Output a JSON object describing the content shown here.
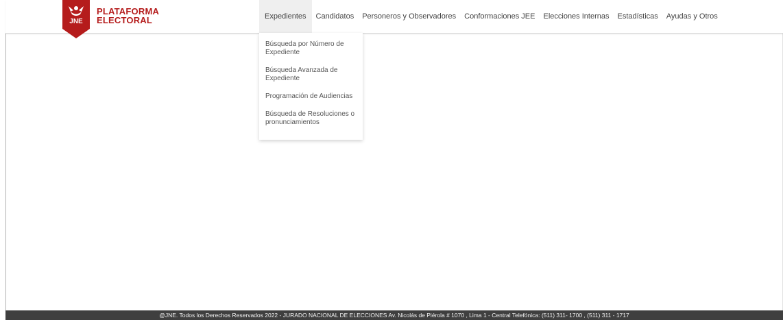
{
  "brand": {
    "shield_text": "JNE",
    "line1": "PLATAFORMA",
    "line2": "ELECTORAL",
    "primary_color": "#b51c1c"
  },
  "nav": {
    "items": [
      {
        "label": "Expedientes",
        "active": true
      },
      {
        "label": "Candidatos"
      },
      {
        "label": "Personeros y Observadores"
      },
      {
        "label": "Conformaciones JEE"
      },
      {
        "label": "Elecciones Internas"
      },
      {
        "label": "Estadísticas"
      },
      {
        "label": "Ayudas y Otros"
      }
    ]
  },
  "dropdown": {
    "items": [
      {
        "label": "Búsqueda por Número de Expediente"
      },
      {
        "label": "Búsqueda Avanzada de Expediente"
      },
      {
        "label": "Programación de Audiencias"
      },
      {
        "label": "Búsqueda de Resoluciones o pronunciamientos"
      }
    ]
  },
  "footer": {
    "text": "@JNE. Todos los Derechos Reservados 2022  -  JURADO NACIONAL DE ELECCIONES Av. Nicolás de Piérola # 1070 , Lima 1 - Central Telefónica: (511) 311- 1700 , (511) 311 - 1717"
  }
}
